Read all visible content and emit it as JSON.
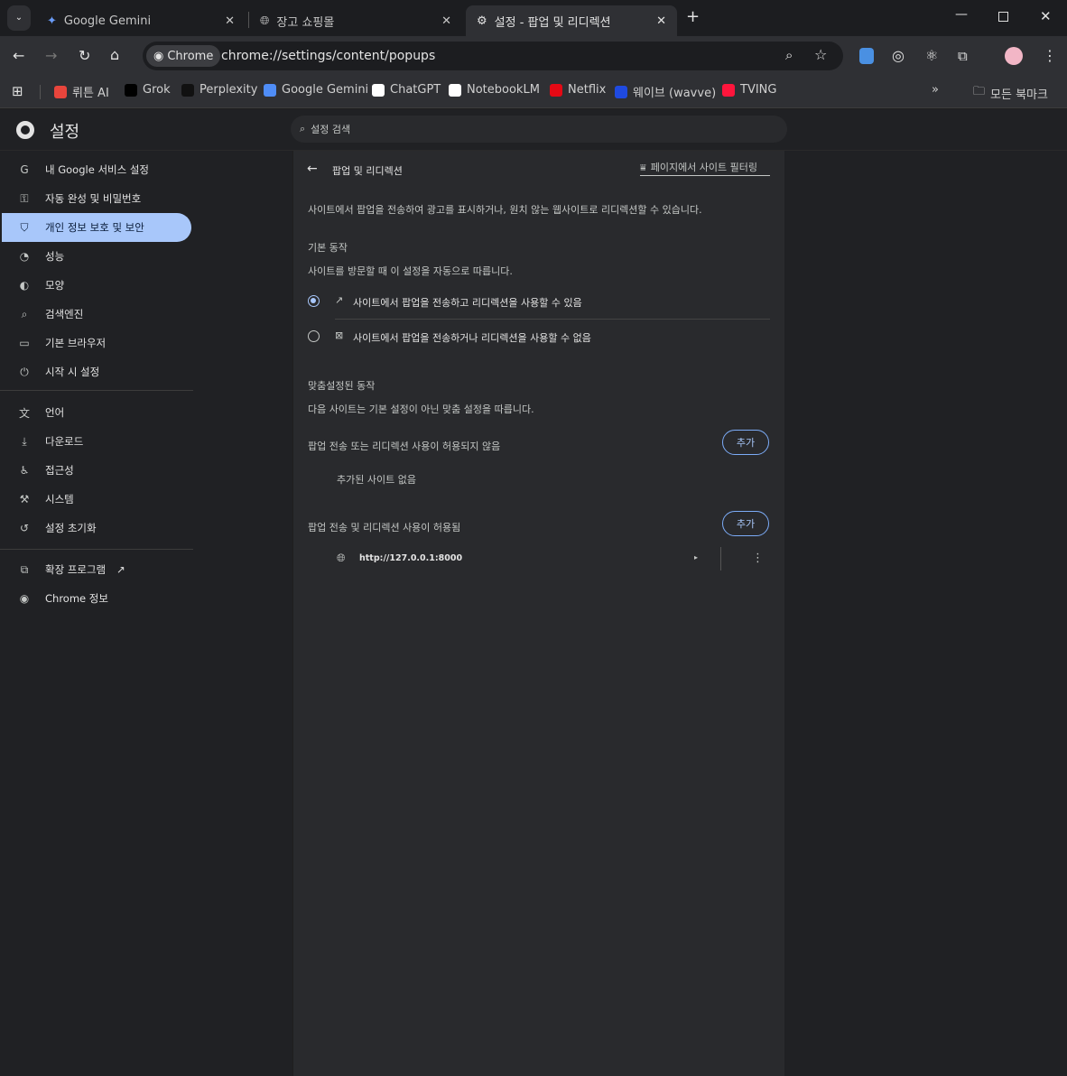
{
  "tabs": [
    {
      "title": "Google Gemini",
      "icon": "gemini-icon"
    },
    {
      "title": "장고 쇼핑몰",
      "icon": "globe-icon"
    },
    {
      "title": "설정 - 팝업 및 리디렉션",
      "icon": "gear-icon",
      "active": true
    }
  ],
  "omnibox": {
    "chip": "Chrome",
    "url": "chrome://settings/content/popups"
  },
  "bookmarks": [
    {
      "label": "뤼튼 AI",
      "color": "#e8453c"
    },
    {
      "label": "Grok",
      "color": "#000000"
    },
    {
      "label": "Perplexity",
      "color": "#111111"
    },
    {
      "label": "Google Gemini",
      "color": "#4f8df7"
    },
    {
      "label": "ChatGPT",
      "color": "#ffffff"
    },
    {
      "label": "NotebookLM",
      "color": "#ffffff"
    },
    {
      "label": "Netflix",
      "color": "#e50914"
    },
    {
      "label": "웨이브 (wavve)",
      "color": "#1f4ae0"
    },
    {
      "label": "TVING",
      "color": "#ff153c"
    }
  ],
  "all_bookmarks": "모든 북마크",
  "settings": {
    "title": "설정",
    "search_placeholder": "설정 검색"
  },
  "sidebar": [
    {
      "label": "내 Google 서비스 설정",
      "icon": "google-icon"
    },
    {
      "label": "자동 완성 및 비밀번호",
      "icon": "key-icon"
    },
    {
      "label": "개인 정보 보호 및 보안",
      "icon": "shield-icon",
      "selected": true
    },
    {
      "label": "성능",
      "icon": "speedometer-icon"
    },
    {
      "label": "모양",
      "icon": "palette-icon"
    },
    {
      "label": "검색엔진",
      "icon": "search-icon"
    },
    {
      "label": "기본 브라우저",
      "icon": "browser-icon"
    },
    {
      "label": "시작 시 설정",
      "icon": "power-icon"
    },
    {
      "label": "언어",
      "icon": "translate-icon"
    },
    {
      "label": "다운로드",
      "icon": "download-icon"
    },
    {
      "label": "접근성",
      "icon": "accessibility-icon"
    },
    {
      "label": "시스템",
      "icon": "wrench-icon"
    },
    {
      "label": "설정 초기화",
      "icon": "reset-icon"
    },
    {
      "label": "확장 프로그램",
      "icon": "puzzle-icon"
    },
    {
      "label": "Chrome 정보",
      "icon": "chrome-icon"
    }
  ],
  "page": {
    "title": "팝업 및 리디렉션",
    "filter_placeholder": "페이지에서 사이트 필터링",
    "description": "사이트에서 팝업을 전송하여 광고를 표시하거나, 원치 않는 웹사이트로 리디렉션할 수 있습니다.",
    "default_heading": "기본 동작",
    "default_sub": "사이트를 방문할 때 이 설정을 자동으로 따릅니다.",
    "option_allow": "사이트에서 팝업을 전송하고 리디렉션을 사용할 수 있음",
    "option_block": "사이트에서 팝업을 전송하거나 리디렉션을 사용할 수 없음",
    "selected_option": "allow",
    "custom_heading": "맞춤설정된 동작",
    "custom_sub": "다음 사이트는 기본 설정이 아닌 맞춤 설정을 따릅니다.",
    "blocked_heading": "팝업 전송 또는 리디렉션 사용이 허용되지 않음",
    "blocked_empty": "추가된 사이트 없음",
    "allowed_heading": "팝업 전송 및 리디렉션 사용이 허용됨",
    "allowed_sites": [
      "http://127.0.0.1:8000"
    ],
    "add_label": "추가"
  },
  "accent": "#a8c7fa"
}
